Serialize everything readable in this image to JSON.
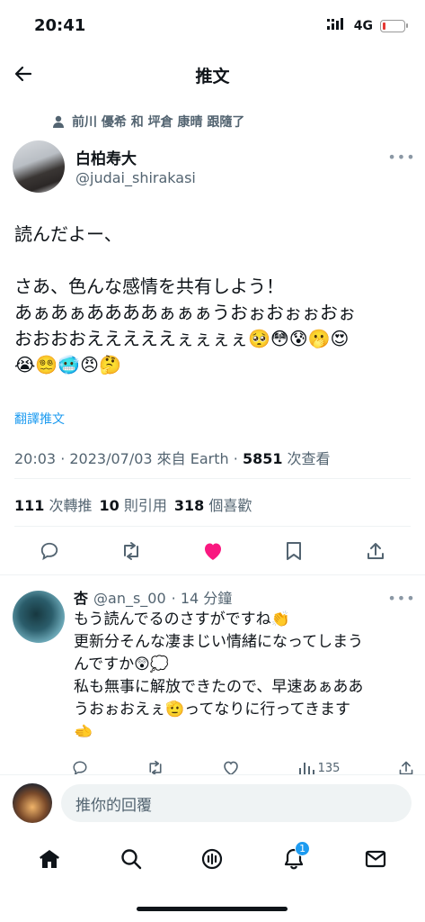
{
  "status": {
    "time": "20:41",
    "network": "4G",
    "battery_level": 0.12
  },
  "header": {
    "title": "推文"
  },
  "tweet": {
    "follow_context": "前川 優希 和 坪倉 康晴 跟隨了",
    "author_name": "白柏寿大",
    "author_handle": "@judai_shirakasi",
    "text": "読んだよー、\n\nさあ、色んな感情を共有しよう！\nあぁあぁああああぁぁぁうおぉおぉぉおぉ\nおおおおえええええぇぇぇぇ🥺😳😰🫢😍\n😭😵‍💫🥶😠🤔",
    "translate_label": "翻譯推文",
    "meta_datetime": "20:03 · 2023/07/03 來自 Earth · ",
    "views": "5851",
    "views_label": " 次查看",
    "retweets": "111",
    "retweets_label": "次轉推",
    "quotes": "10",
    "quotes_label": "則引用",
    "likes": "318",
    "likes_label": "個喜歡",
    "liked": true
  },
  "reply": {
    "name": "杏",
    "handle": "@an_s_00",
    "time": "· 14 分鐘",
    "text": "もう読んでるのさすがですね👏\n更新分そんな凄まじい情緒になってしまう\nんですか😲💭\n私も無事に解放できたので、早速あぁああ\nうおぉおえぇ🫡ってなりに行ってきます\n🫲",
    "views": "135"
  },
  "composer": {
    "placeholder": "推你的回覆"
  },
  "tabbar": {
    "notifications_badge": "1"
  },
  "colors": {
    "accent": "#1d9bf0",
    "like": "#f91880"
  }
}
